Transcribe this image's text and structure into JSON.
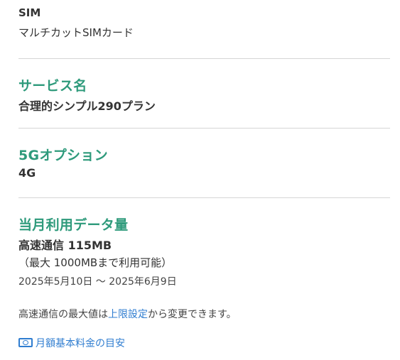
{
  "sim": {
    "label": "SIM",
    "value": "マルチカットSIMカード"
  },
  "service": {
    "label": "サービス名",
    "value": "合理的シンプル290プラン"
  },
  "option5g": {
    "label": "5Gオプション",
    "value": "4G"
  },
  "usage": {
    "label": "当月利用データ量",
    "value": "高速通信 115MB",
    "limit_note": "（最大 1000MBまで利用可能）",
    "period": "2025年5月10日 〜 2025年6月9日"
  },
  "note": {
    "prefix": "高速通信の最大値は",
    "link": "上限設定",
    "suffix": "から変更できます。"
  },
  "fee_link": {
    "icon": "money-icon",
    "label": "月額基本料金の目安"
  },
  "colors": {
    "heading": "#2e9a7b",
    "link": "#2f7dd0",
    "divider": "#d6d6d6"
  }
}
